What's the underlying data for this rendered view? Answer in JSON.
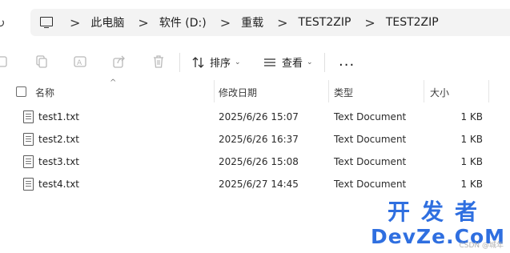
{
  "address_bar": {
    "crumbs": [
      "此电脑",
      "软件 (D:)",
      "重载",
      "TEST2ZIP",
      "TEST2ZIP"
    ],
    "separator": ">"
  },
  "toolbar": {
    "sort_label": "排序",
    "view_label": "查看",
    "more_label": "...",
    "icons": [
      "cut-icon",
      "copy-icon",
      "rename-icon",
      "share-icon",
      "delete-icon",
      "sort-icon",
      "view-icon"
    ]
  },
  "header": {
    "columns": [
      "名称",
      "修改日期",
      "类型",
      "大小"
    ],
    "sort_indicator": "^"
  },
  "files": [
    {
      "name": "test1.txt",
      "date": "2025/6/26 15:07",
      "type": "Text Document",
      "size": "1 KB"
    },
    {
      "name": "test2.txt",
      "date": "2025/6/26 16:37",
      "type": "Text Document",
      "size": "1 KB"
    },
    {
      "name": "test3.txt",
      "date": "2025/6/26 15:08",
      "type": "Text Document",
      "size": "1 KB"
    },
    {
      "name": "test4.txt",
      "date": "2025/6/27 14:45",
      "type": "Text Document",
      "size": "1 KB"
    }
  ],
  "watermark": {
    "top": "开发者",
    "bottom": "DevZe.CoM",
    "small": "CSDN @城年"
  },
  "colors": {
    "accent": "#2f6fe0",
    "address_bg": "#f3f3f3"
  }
}
